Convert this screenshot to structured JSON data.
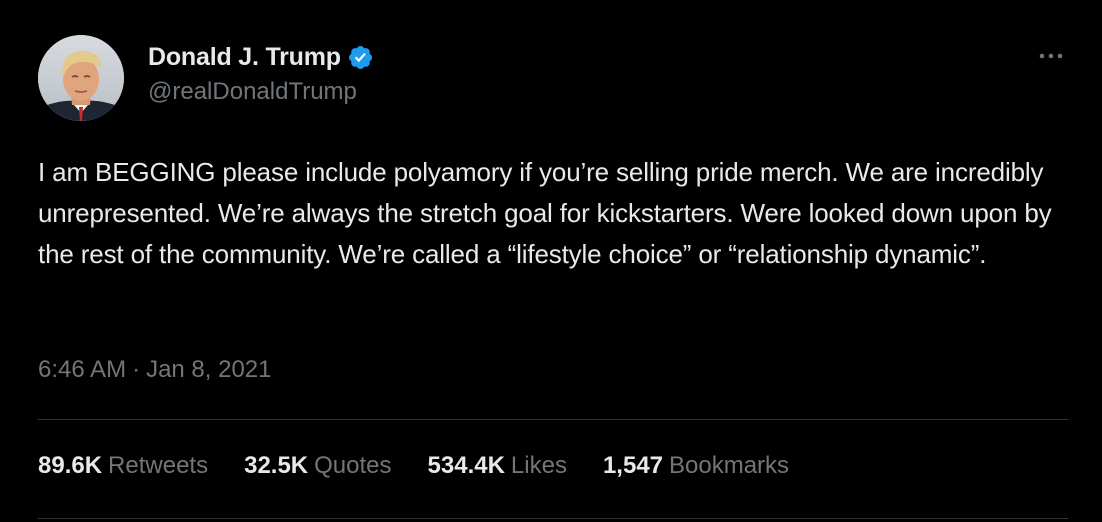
{
  "author": {
    "display_name": "Donald J. Trump",
    "handle": "@realDonaldTrump",
    "verified": true,
    "verified_icon": "verified-badge-icon",
    "avatar_icon": "profile-photo"
  },
  "menu": {
    "more_icon": "more-options-icon"
  },
  "tweet": {
    "text": "I am BEGGING please include polyamory if you’re selling pride merch. We are incredibly unrepresented. We’re always the stretch goal for kickstarters. Were looked down upon by the rest of the community. We’re called a “lifestyle choice” or “relationship dynamic”.",
    "time": "6:46 AM",
    "separator": "·",
    "date": "Jan 8, 2021"
  },
  "stats": [
    {
      "value": "89.6K",
      "label": "Retweets"
    },
    {
      "value": "32.5K",
      "label": "Quotes"
    },
    {
      "value": "534.4K",
      "label": "Likes"
    },
    {
      "value": "1,547",
      "label": "Bookmarks"
    }
  ],
  "colors": {
    "background": "#000000",
    "primary_text": "#e7e9ea",
    "secondary_text": "#71767b",
    "divider": "#2f3336",
    "verified_blue": "#1d9bf0"
  }
}
